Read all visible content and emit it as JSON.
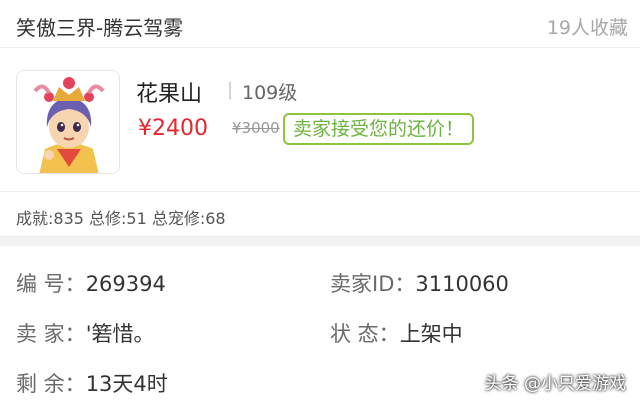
{
  "header": {
    "title": "笑傲三界-腾云驾雾",
    "favorites": "19人收藏"
  },
  "item": {
    "server": "花果山",
    "divider": "|",
    "level": "109级",
    "price": "¥2400",
    "original_price": "¥3000",
    "offer_badge": "卖家接受您的还价！",
    "stats": "成就:835 总修:51 总宠修:68"
  },
  "details": {
    "id_label": "编  号：",
    "id_value": "269394",
    "seller_id_label": "卖家ID：",
    "seller_id_value": "3110060",
    "seller_label": "卖  家：",
    "seller_value": "'箬惜。",
    "status_label": "状  态：",
    "status_value": "上架中",
    "remaining_label": "剩  余：",
    "remaining_value": "13天4时"
  },
  "watermark": "头条 @小只爱游戏",
  "colors": {
    "price": "#e8242d",
    "offer_border": "#8cc63f",
    "offer_text": "#6db33f"
  },
  "icons": {
    "avatar": "character-avatar-icon"
  }
}
